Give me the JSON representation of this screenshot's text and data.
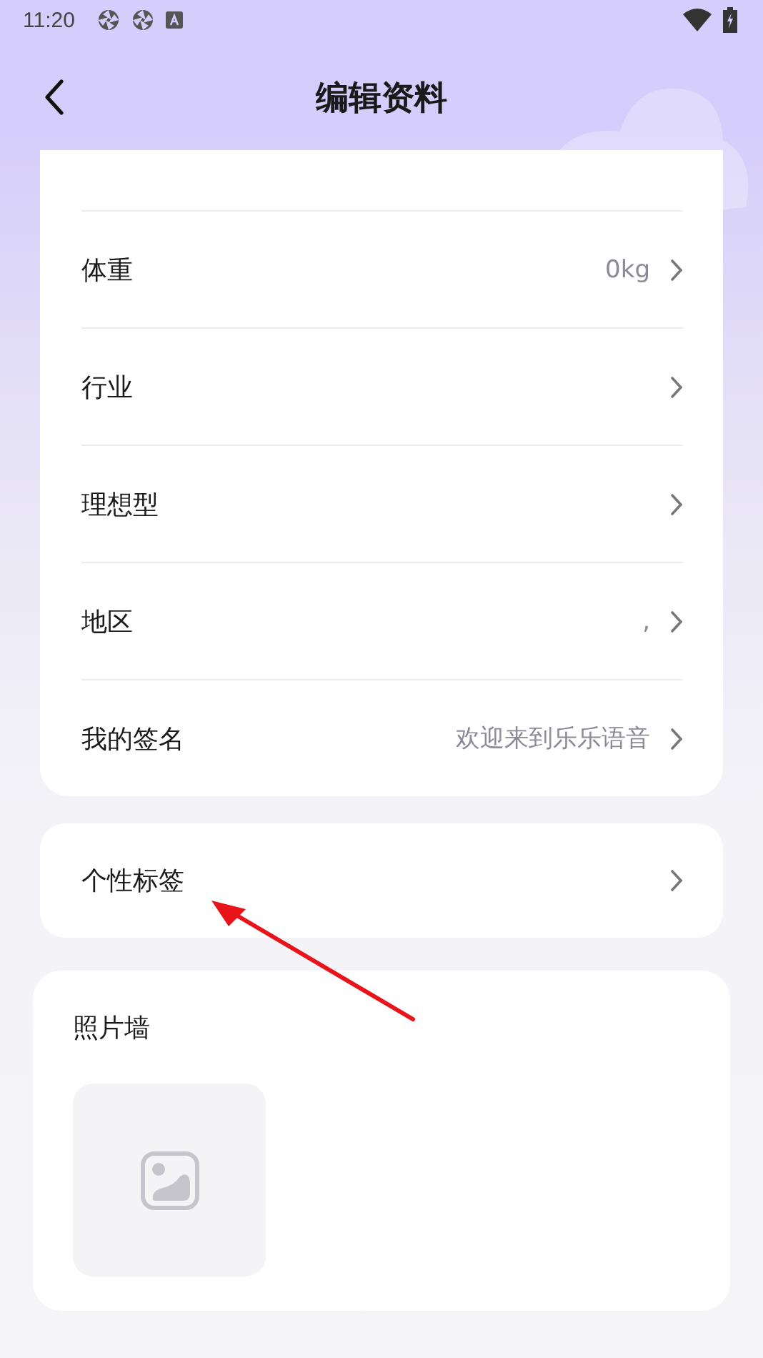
{
  "status_bar": {
    "time": "11:20"
  },
  "header": {
    "title": "编辑资料"
  },
  "profile_fields": [
    {
      "label": "体重",
      "value": "0kg"
    },
    {
      "label": "行业"
    },
    {
      "label": "理想型"
    },
    {
      "label": "地区",
      "value": ","
    },
    {
      "label": "我的签名",
      "value": "欢迎来到乐乐语音"
    }
  ],
  "tags_row": {
    "label": "个性标签"
  },
  "photo_wall": {
    "title": "照片墙"
  }
}
